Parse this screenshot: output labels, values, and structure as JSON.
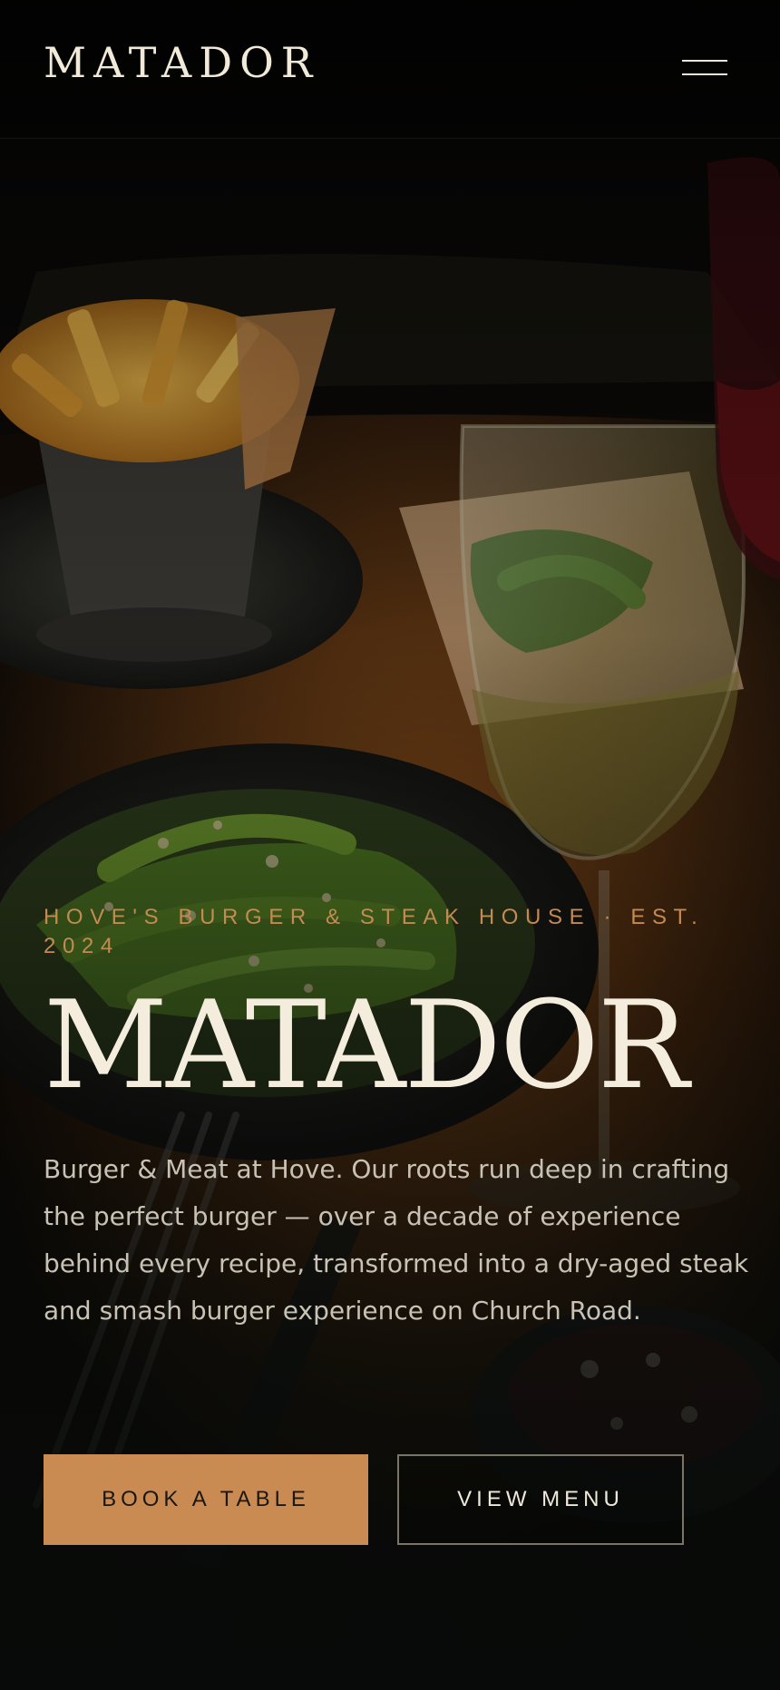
{
  "header": {
    "logo_text": "MATADOR",
    "menu_icon": "hamburger-menu-icon"
  },
  "hero": {
    "eyebrow": "HOVE'S BURGER & STEAK HOUSE · EST. 2024",
    "title": "MATADOR",
    "description": "Burger & Meat at Hove. Our roots run deep in crafting the perfect burger — over a decade of experience behind every recipe, transformed into a dry-aged steak and smash burger experience on Church Road.",
    "background_image": "restaurant-table-food-photo"
  },
  "cta": {
    "book_label": "BOOK A TABLE",
    "menu_label": "VIEW MENU"
  },
  "colors": {
    "accent": "#c98b51",
    "eyebrow": "#c48a52",
    "title": "#f4ecdc",
    "body_text": "#c8c2b4",
    "background": "#0b0c0b"
  }
}
